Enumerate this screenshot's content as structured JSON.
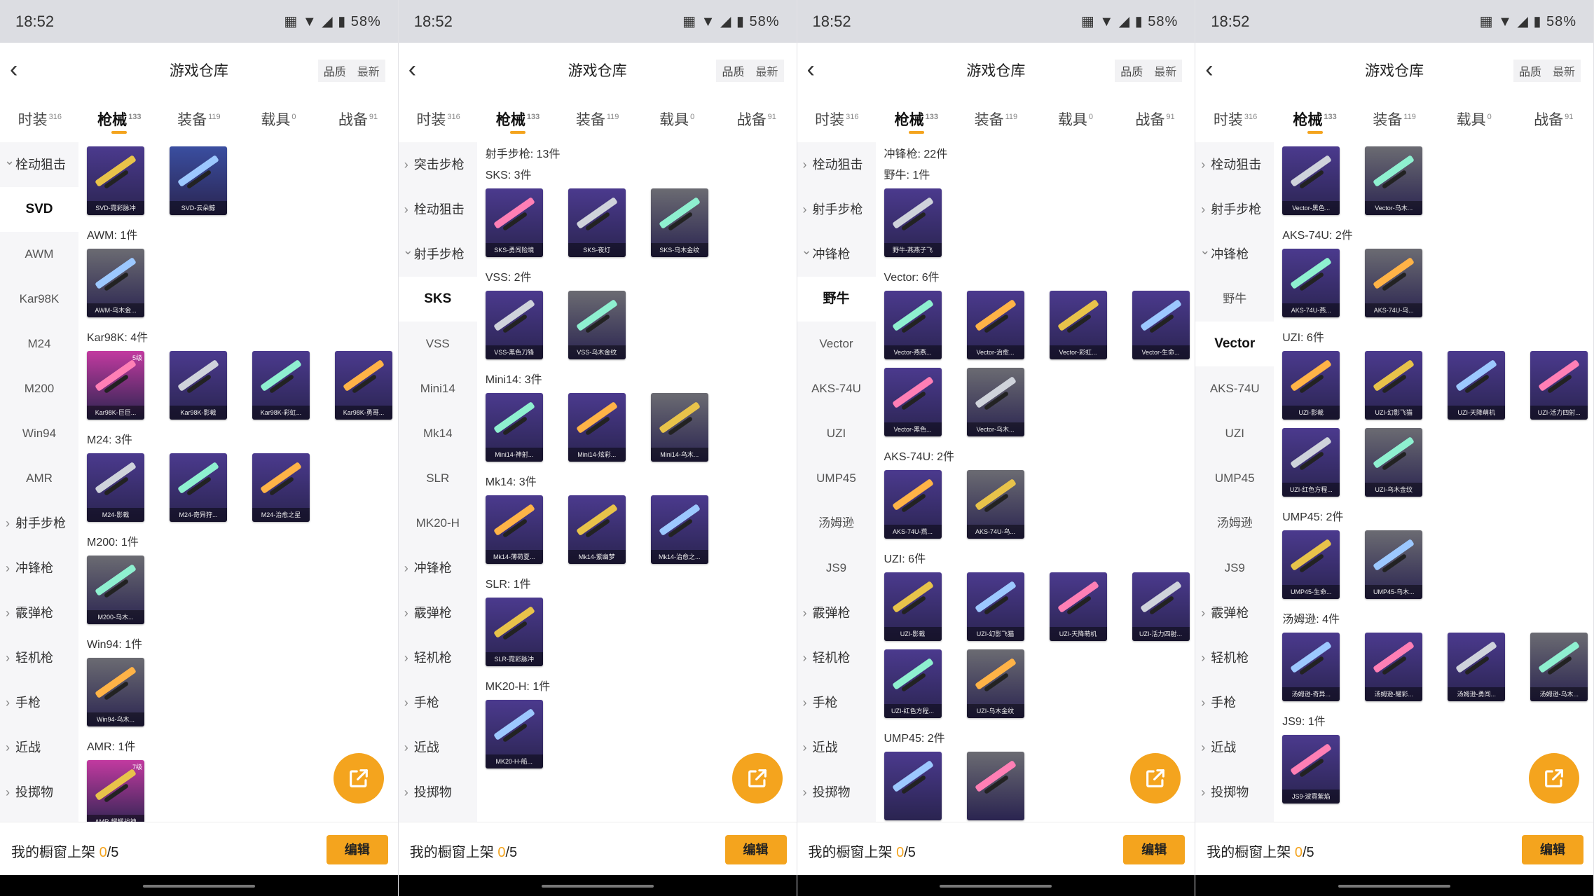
{
  "status": {
    "time": "18:52",
    "battery": "58%"
  },
  "page": {
    "title": "游戏仓库",
    "back_icon": "back-chevron-icon",
    "sort_quality": "品质",
    "sort_latest": "最新"
  },
  "tabs": [
    {
      "label": "时装",
      "count": "316"
    },
    {
      "label": "枪械",
      "count": "133",
      "active": true
    },
    {
      "label": "装备",
      "count": "119"
    },
    {
      "label": "载具",
      "count": "0"
    },
    {
      "label": "战备",
      "count": "91"
    }
  ],
  "bottom": {
    "shelf_label": "我的橱窗上架 ",
    "shelf_count": "0",
    "shelf_total": "/5",
    "edit_label": "编辑"
  },
  "colors": {
    "accent": "#f4a41e",
    "card_purple": "#4b3a8e",
    "card_blue": "#3a4ea0",
    "card_gray": "#6b6b72",
    "card_pink": "#c23aa0",
    "card_yellow": "#c9a82a"
  },
  "panels": [
    {
      "sidebar": [
        {
          "label": "栓动狙击",
          "kind": "open"
        },
        {
          "label": "SVD",
          "kind": "sub",
          "selected": true
        },
        {
          "label": "AWM",
          "kind": "sub"
        },
        {
          "label": "Kar98K",
          "kind": "sub"
        },
        {
          "label": "M24",
          "kind": "sub"
        },
        {
          "label": "M200",
          "kind": "sub"
        },
        {
          "label": "Win94",
          "kind": "sub"
        },
        {
          "label": "AMR",
          "kind": "sub"
        },
        {
          "label": "射手步枪",
          "kind": "cat"
        },
        {
          "label": "冲锋枪",
          "kind": "cat"
        },
        {
          "label": "霰弹枪",
          "kind": "cat"
        },
        {
          "label": "轻机枪",
          "kind": "cat"
        },
        {
          "label": "手枪",
          "kind": "cat"
        },
        {
          "label": "近战",
          "kind": "cat"
        },
        {
          "label": "投掷物",
          "kind": "cat"
        }
      ],
      "groups": [
        {
          "title": "",
          "items": [
            {
              "name": "SVD-霓彩脉冲",
              "color": "card_purple"
            },
            {
              "name": "SVD-云朵鲸",
              "color": "card_blue"
            }
          ]
        },
        {
          "title": "AWM: 1件",
          "items": [
            {
              "name": "AWM-乌木金...",
              "color": "card_gray"
            }
          ]
        },
        {
          "title": "Kar98K: 4件",
          "items": [
            {
              "name": "Kar98K-巨巨...",
              "color": "card_pink",
              "badge": "5级"
            },
            {
              "name": "Kar98K-影裁",
              "color": "card_purple"
            },
            {
              "name": "Kar98K-彩虹...",
              "color": "card_purple"
            },
            {
              "name": "Kar98K-勇哥...",
              "color": "card_purple"
            }
          ]
        },
        {
          "title": "M24: 3件",
          "items": [
            {
              "name": "M24-影裁",
              "color": "card_purple"
            },
            {
              "name": "M24-奇异狩...",
              "color": "card_purple"
            },
            {
              "name": "M24-治愈之星",
              "color": "card_purple"
            }
          ]
        },
        {
          "title": "M200: 1件",
          "items": [
            {
              "name": "M200-乌木...",
              "color": "card_gray"
            }
          ]
        },
        {
          "title": "Win94: 1件",
          "items": [
            {
              "name": "Win94-乌木...",
              "color": "card_gray"
            }
          ]
        },
        {
          "title": "AMR: 1件",
          "items": [
            {
              "name": "AMR-耀耀战神",
              "color": "card_pink",
              "badge": "7级"
            }
          ]
        }
      ]
    },
    {
      "sidebar": [
        {
          "label": "突击步枪",
          "kind": "cat"
        },
        {
          "label": "栓动狙击",
          "kind": "cat"
        },
        {
          "label": "射手步枪",
          "kind": "open"
        },
        {
          "label": "SKS",
          "kind": "sub",
          "selected": true
        },
        {
          "label": "VSS",
          "kind": "sub"
        },
        {
          "label": "Mini14",
          "kind": "sub"
        },
        {
          "label": "Mk14",
          "kind": "sub"
        },
        {
          "label": "SLR",
          "kind": "sub"
        },
        {
          "label": "MK20-H",
          "kind": "sub"
        },
        {
          "label": "冲锋枪",
          "kind": "cat"
        },
        {
          "label": "霰弹枪",
          "kind": "cat"
        },
        {
          "label": "轻机枪",
          "kind": "cat"
        },
        {
          "label": "手枪",
          "kind": "cat"
        },
        {
          "label": "近战",
          "kind": "cat"
        },
        {
          "label": "投掷物",
          "kind": "cat"
        }
      ],
      "groups": [
        {
          "title": "射手步枪: 13件",
          "items": []
        },
        {
          "title": "SKS: 3件",
          "items": [
            {
              "name": "SKS-勇闯险境",
              "color": "card_purple"
            },
            {
              "name": "SKS-夜灯",
              "color": "card_purple"
            },
            {
              "name": "SKS-乌木金纹",
              "color": "card_gray"
            }
          ]
        },
        {
          "title": "VSS: 2件",
          "items": [
            {
              "name": "VSS-黑色刀锋",
              "color": "card_purple"
            },
            {
              "name": "VSS-乌木金纹",
              "color": "card_gray"
            }
          ]
        },
        {
          "title": "Mini14: 3件",
          "items": [
            {
              "name": "Mini14-神射...",
              "color": "card_purple"
            },
            {
              "name": "Mini14-炫彩...",
              "color": "card_purple"
            },
            {
              "name": "Mini14-乌木...",
              "color": "card_gray"
            }
          ]
        },
        {
          "title": "Mk14: 3件",
          "items": [
            {
              "name": "Mk14-薄荷夏...",
              "color": "card_purple"
            },
            {
              "name": "Mk14-紫幽梦",
              "color": "card_purple"
            },
            {
              "name": "Mk14-治愈之...",
              "color": "card_purple"
            }
          ]
        },
        {
          "title": "SLR: 1件",
          "items": [
            {
              "name": "SLR-霓彩脉冲",
              "color": "card_purple"
            }
          ]
        },
        {
          "title": "MK20-H: 1件",
          "items": [
            {
              "name": "MK20-H-船...",
              "color": "card_purple"
            }
          ]
        }
      ]
    },
    {
      "sidebar": [
        {
          "label": "栓动狙击",
          "kind": "cat"
        },
        {
          "label": "射手步枪",
          "kind": "cat"
        },
        {
          "label": "冲锋枪",
          "kind": "open"
        },
        {
          "label": "野牛",
          "kind": "sub",
          "selected": true
        },
        {
          "label": "Vector",
          "kind": "sub"
        },
        {
          "label": "AKS-74U",
          "kind": "sub"
        },
        {
          "label": "UZI",
          "kind": "sub"
        },
        {
          "label": "UMP45",
          "kind": "sub"
        },
        {
          "label": "汤姆逊",
          "kind": "sub"
        },
        {
          "label": "JS9",
          "kind": "sub"
        },
        {
          "label": "霰弹枪",
          "kind": "cat"
        },
        {
          "label": "轻机枪",
          "kind": "cat"
        },
        {
          "label": "手枪",
          "kind": "cat"
        },
        {
          "label": "近战",
          "kind": "cat"
        },
        {
          "label": "投掷物",
          "kind": "cat"
        }
      ],
      "groups": [
        {
          "title": "冲锋枪: 22件",
          "items": []
        },
        {
          "title": "野牛: 1件",
          "items": [
            {
              "name": "野牛-燕燕子飞",
              "color": "card_purple"
            }
          ]
        },
        {
          "title": "Vector: 6件",
          "items": [
            {
              "name": "Vector-燕燕...",
              "color": "card_purple"
            },
            {
              "name": "Vector-治愈...",
              "color": "card_purple"
            },
            {
              "name": "Vector-彩虹...",
              "color": "card_purple"
            },
            {
              "name": "Vector-生命...",
              "color": "card_purple"
            },
            {
              "name": "Vector-黑色...",
              "color": "card_purple"
            },
            {
              "name": "Vector-乌木...",
              "color": "card_gray"
            }
          ]
        },
        {
          "title": "AKS-74U: 2件",
          "items": [
            {
              "name": "AKS-74U-燕...",
              "color": "card_purple"
            },
            {
              "name": "AKS-74U-乌...",
              "color": "card_gray"
            }
          ]
        },
        {
          "title": "UZI: 6件",
          "items": [
            {
              "name": "UZI-影裁",
              "color": "card_purple"
            },
            {
              "name": "UZI-幻影飞猫",
              "color": "card_purple"
            },
            {
              "name": "UZI-天降萌机",
              "color": "card_purple"
            },
            {
              "name": "UZI-活力四射...",
              "color": "card_purple"
            },
            {
              "name": "UZI-红色方程...",
              "color": "card_purple"
            },
            {
              "name": "UZI-乌木金纹",
              "color": "card_gray"
            }
          ]
        },
        {
          "title": "UMP45: 2件",
          "items": [
            {
              "name": "",
              "color": "card_purple"
            },
            {
              "name": "",
              "color": "card_gray"
            }
          ]
        }
      ]
    },
    {
      "sidebar": [
        {
          "label": "栓动狙击",
          "kind": "cat"
        },
        {
          "label": "射手步枪",
          "kind": "cat"
        },
        {
          "label": "冲锋枪",
          "kind": "open"
        },
        {
          "label": "野牛",
          "kind": "sub"
        },
        {
          "label": "Vector",
          "kind": "sub",
          "selected": true
        },
        {
          "label": "AKS-74U",
          "kind": "sub"
        },
        {
          "label": "UZI",
          "kind": "sub"
        },
        {
          "label": "UMP45",
          "kind": "sub"
        },
        {
          "label": "汤姆逊",
          "kind": "sub"
        },
        {
          "label": "JS9",
          "kind": "sub"
        },
        {
          "label": "霰弹枪",
          "kind": "cat"
        },
        {
          "label": "轻机枪",
          "kind": "cat"
        },
        {
          "label": "手枪",
          "kind": "cat"
        },
        {
          "label": "近战",
          "kind": "cat"
        },
        {
          "label": "投掷物",
          "kind": "cat"
        }
      ],
      "groups": [
        {
          "title": "",
          "items": [
            {
              "name": "Vector-黑色...",
              "color": "card_purple"
            },
            {
              "name": "Vector-乌木...",
              "color": "card_gray"
            }
          ]
        },
        {
          "title": "AKS-74U: 2件",
          "items": [
            {
              "name": "AKS-74U-燕...",
              "color": "card_purple"
            },
            {
              "name": "AKS-74U-乌...",
              "color": "card_gray"
            }
          ]
        },
        {
          "title": "UZI: 6件",
          "items": [
            {
              "name": "UZI-影裁",
              "color": "card_purple"
            },
            {
              "name": "UZI-幻影飞猫",
              "color": "card_purple"
            },
            {
              "name": "UZI-天降萌机",
              "color": "card_purple"
            },
            {
              "name": "UZI-活力四射...",
              "color": "card_purple"
            },
            {
              "name": "UZI-红色方程...",
              "color": "card_purple"
            },
            {
              "name": "UZI-乌木金纹",
              "color": "card_gray"
            }
          ]
        },
        {
          "title": "UMP45: 2件",
          "items": [
            {
              "name": "UMP45-生命...",
              "color": "card_purple"
            },
            {
              "name": "UMP45-乌木...",
              "color": "card_gray"
            }
          ]
        },
        {
          "title": "汤姆逊: 4件",
          "items": [
            {
              "name": "汤姆逊-奇异...",
              "color": "card_purple"
            },
            {
              "name": "汤姆逊-耀彩...",
              "color": "card_purple"
            },
            {
              "name": "汤姆逊-勇闯...",
              "color": "card_purple"
            },
            {
              "name": "汤姆逊-乌木...",
              "color": "card_gray"
            }
          ]
        },
        {
          "title": "JS9: 1件",
          "items": [
            {
              "name": "JS9-波霓紫焰",
              "color": "card_purple"
            }
          ]
        }
      ]
    }
  ]
}
